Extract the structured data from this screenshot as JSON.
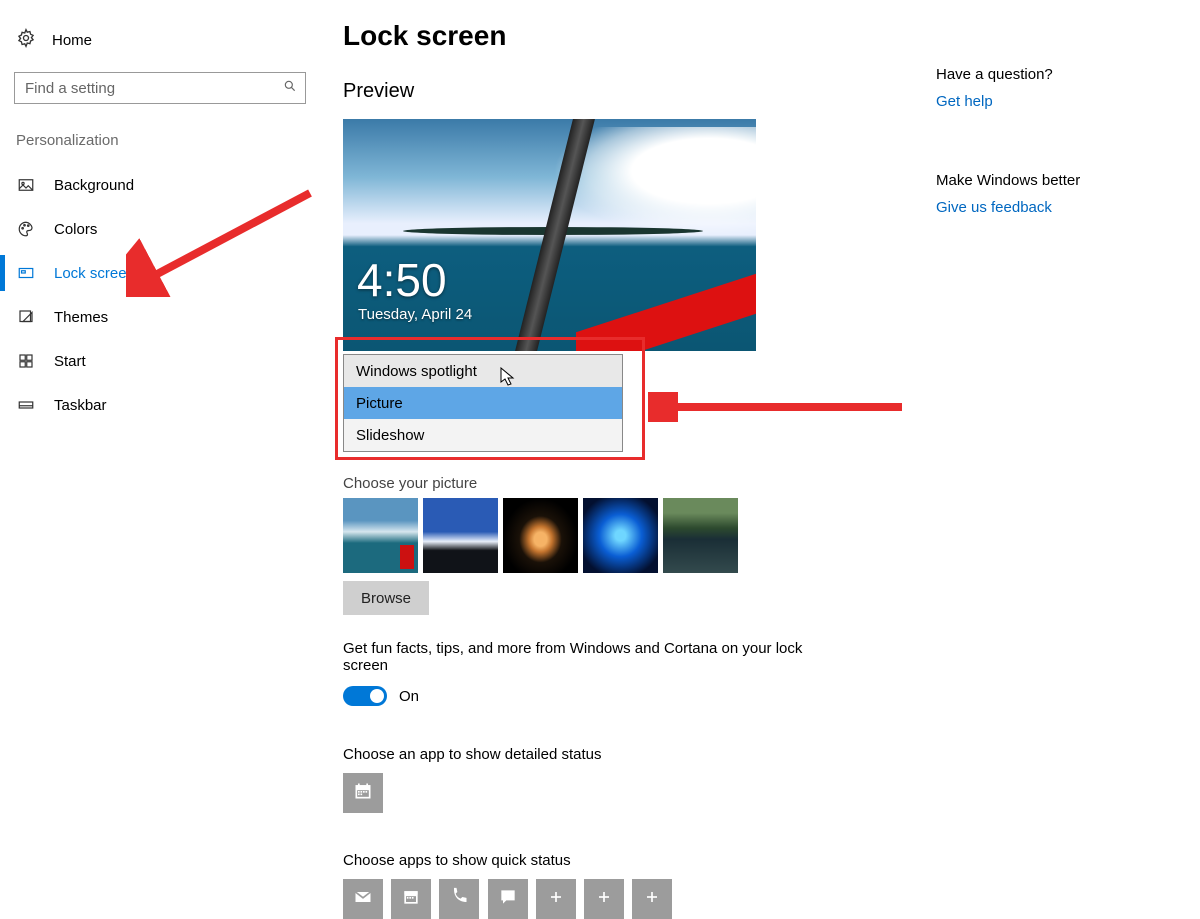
{
  "sidebar": {
    "home": "Home",
    "searchPlaceholder": "Find a setting",
    "sectionTitle": "Personalization",
    "items": [
      {
        "label": "Background"
      },
      {
        "label": "Colors"
      },
      {
        "label": "Lock screen"
      },
      {
        "label": "Themes"
      },
      {
        "label": "Start"
      },
      {
        "label": "Taskbar"
      }
    ]
  },
  "main": {
    "title": "Lock screen",
    "previewHeading": "Preview",
    "previewTime": "4:50",
    "previewDate": "Tuesday, April 24",
    "dropdownOptions": [
      "Windows spotlight",
      "Picture",
      "Slideshow"
    ],
    "choosePicture": "Choose your picture",
    "browse": "Browse",
    "funFacts": "Get fun facts, tips, and more from Windows and Cortana on your lock screen",
    "toggleLabel": "On",
    "detailedStatus": "Choose an app to show detailed status",
    "quickStatus": "Choose apps to show quick status"
  },
  "right": {
    "questionTitle": "Have a question?",
    "getHelp": "Get help",
    "betterTitle": "Make Windows better",
    "feedback": "Give us feedback"
  }
}
